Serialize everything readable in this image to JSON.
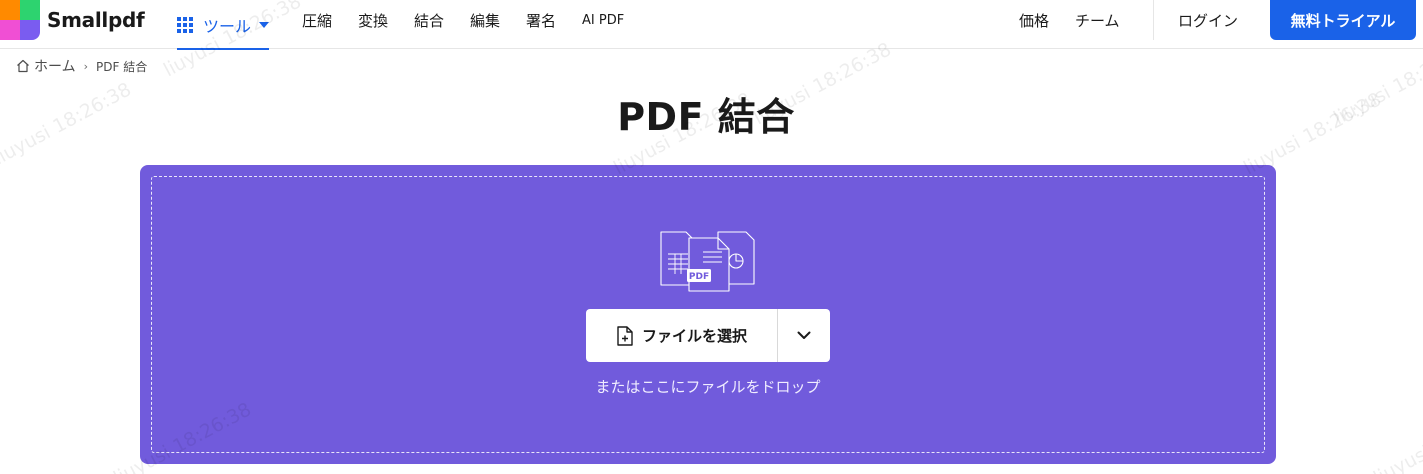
{
  "header": {
    "logo_text": "Smallpdf",
    "tools_label": "ツール",
    "nav": [
      "圧縮",
      "変換",
      "結合",
      "編集",
      "署名"
    ],
    "ai_label": "AI PDF",
    "pricing_label": "価格",
    "team_label": "チーム",
    "login_label": "ログイン",
    "trial_label": "無料トライアル"
  },
  "breadcrumb": {
    "home_label": "ホーム",
    "separator": "›",
    "current_label": "PDF 結合"
  },
  "main": {
    "title": "PDF 結合",
    "choose_file_label": "ファイルを選択",
    "drop_hint": "またはここにファイルをドロップ",
    "illustration_pdf_label": "PDF"
  },
  "watermark": {
    "text": "liuyusi  18:26:38"
  },
  "colors": {
    "brand_blue": "#1a62e8",
    "dropzone_purple": "#715bdc",
    "logo_orange": "#ff8a00",
    "logo_green": "#2dd36f",
    "logo_pink": "#f04fd4",
    "logo_purple": "#7a5cf0"
  },
  "icons": {
    "tools": "grid-icon",
    "home": "home-icon",
    "choose_file": "file-add-icon",
    "dropdown": "chevron-down-icon"
  }
}
